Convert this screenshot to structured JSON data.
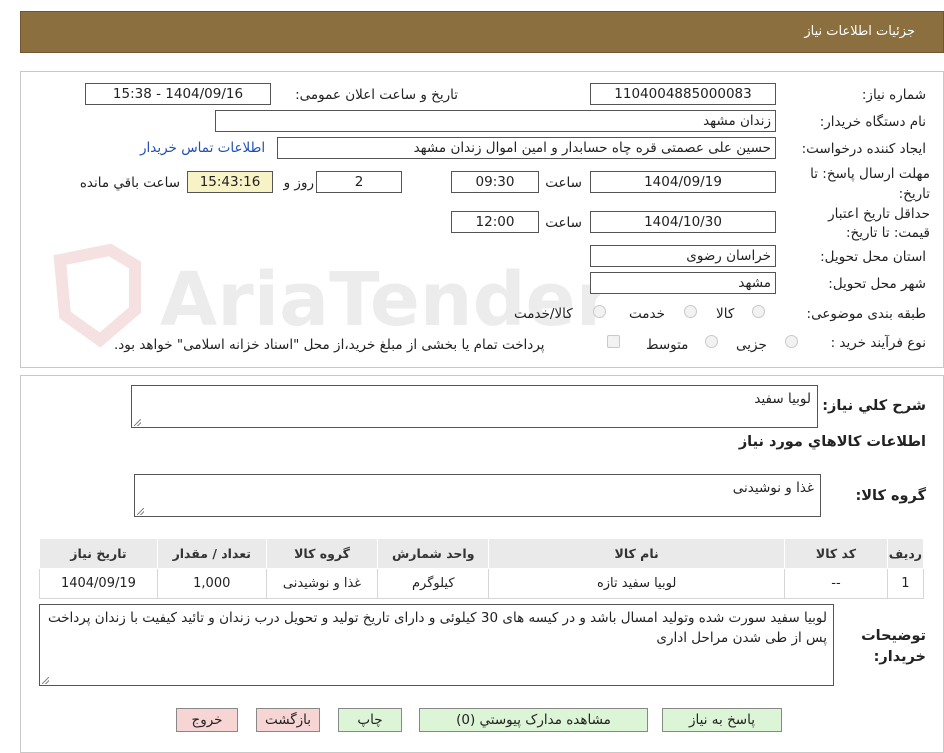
{
  "header": {
    "title": "جزئیات اطلاعات نیاز"
  },
  "watermark": {
    "text": "AriaTender.net"
  },
  "fields": {
    "need_number_label": "شماره نیاز:",
    "need_number": "1104004885000083",
    "announce_label": "تاریخ و ساعت اعلان عمومی:",
    "announce_value": "1404/09/16 - 15:38",
    "buyer_label": "نام دستگاه خریدار:",
    "buyer_value": "زندان مشهد",
    "creator_label": "ایجاد کننده درخواست:",
    "creator_value": "حسین علی عصمتی قره چاه حسابدار و امین اموال زندان مشهد",
    "contact_link": "اطلاعات تماس خریدار",
    "deadline_label": "مهلت ارسال پاسخ: تا تاریخ:",
    "deadline_date": "1404/09/19",
    "time_label": "ساعت",
    "deadline_time": "09:30",
    "days_value": "2",
    "days_label": "روز و",
    "remaining_time": "15:43:16",
    "remaining_label": "ساعت باقي مانده",
    "validity_label": "حداقل تاریخ اعتبار قیمت: تا تاریخ:",
    "validity_date": "1404/10/30",
    "validity_time_label": "ساعت",
    "validity_time": "12:00",
    "province_label": "استان محل تحویل:",
    "province_value": "خراسان رضوی",
    "city_label": "شهر محل تحویل:",
    "city_value": "مشهد",
    "category_label": "طبقه بندی موضوعی:",
    "category_options": [
      "کالا",
      "خدمت",
      "کالا/خدمت"
    ],
    "process_label": "نوع فرآیند خرید :",
    "process_options": [
      "جزیی",
      "متوسط"
    ],
    "payment_note": "پرداخت تمام یا بخشی از مبلغ خرید،از محل \"اسناد خزانه اسلامی\" خواهد بود."
  },
  "description": {
    "label": "شرح کلي نياز:",
    "value": "لوبیا سفید"
  },
  "goods_section": {
    "title": "اطلاعات کالاهاي مورد نياز"
  },
  "goods_group": {
    "label": "گروه کالا:",
    "value": "غذا و نوشیدنی"
  },
  "table": {
    "headers": [
      "رديف",
      "کد کالا",
      "نام کالا",
      "واحد شمارش",
      "گروه کالا",
      "تعداد / مقدار",
      "تاريخ نياز"
    ],
    "rows": [
      [
        "1",
        "--",
        "لوبیا سفید تازه",
        "کیلوگرم",
        "غذا و نوشیدنی",
        "1,000",
        "1404/09/19"
      ]
    ]
  },
  "buyer_notes": {
    "label": "توضیحات خریدار:",
    "value": "لوبیا سفید سورت شده وتولید امسال باشد و در کیسه های 30 کیلوئی و دارای تاریخ تولید و تحویل درب زندان و تائید کیفیت با زندان پرداخت پس از طی شدن مراحل اداری"
  },
  "buttons": {
    "reply": "پاسخ به نياز",
    "attachments": "مشاهده مدارک پیوستي (0)",
    "print": "چاپ",
    "back": "بازگشت",
    "exit": "خروج"
  }
}
